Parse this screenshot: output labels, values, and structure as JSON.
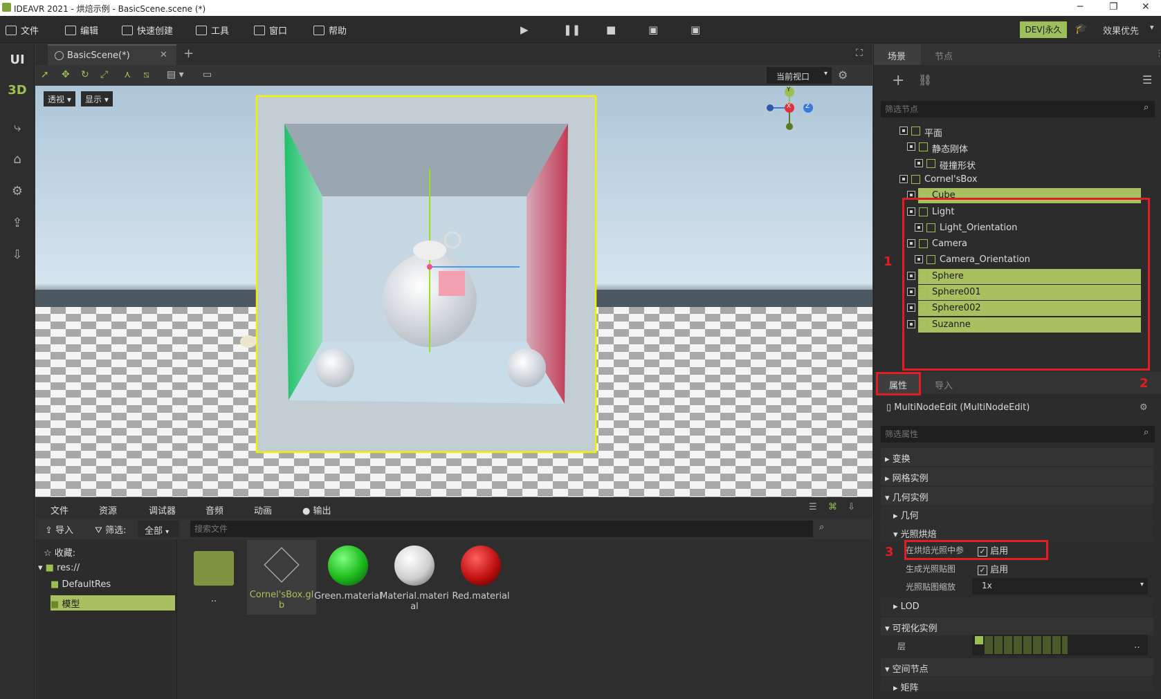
{
  "window": {
    "title": "IDEAVR 2021 - 烘焙示例 - BasicScene.scene (*)"
  },
  "menu": {
    "file": "文件",
    "edit": "编辑",
    "quick_create": "快速创建",
    "tools": "工具",
    "window": "窗口",
    "help": "帮助"
  },
  "header": {
    "dev_badge": "DEV|永久",
    "quality": "效果优先"
  },
  "left_tools": {
    "ui": "UI",
    "three_d": "3D"
  },
  "viewport": {
    "tab_label": "BasicScene(*)",
    "view_select": "当前视口",
    "perspective_btn": "透视",
    "display_btn": "显示",
    "gizmo": {
      "y": "Y",
      "x": "X",
      "z": "Z"
    }
  },
  "bottom": {
    "tabs": [
      "文件",
      "资源",
      "调试器",
      "音频",
      "动画",
      "输出"
    ],
    "import_label": "导入",
    "filter_label": "筛选:",
    "filter_value": "全部",
    "search_placeholder": "搜索文件",
    "tree": {
      "favorites": "收藏:",
      "res": "res://",
      "default_res": "DefaultRes",
      "models": "模型"
    },
    "assets": [
      {
        "name": "..",
        "kind": "folder"
      },
      {
        "name": "Cornel'sBox.glb",
        "kind": "mesh"
      },
      {
        "name": "Green.material",
        "kind": "material",
        "color": "#1cb81c"
      },
      {
        "name": "Material.material",
        "kind": "material",
        "color": "#cfcfcf"
      },
      {
        "name": "Red.material",
        "kind": "material",
        "color": "#c01010"
      }
    ]
  },
  "scene_panel": {
    "tabs": {
      "scene": "场景",
      "node": "节点"
    },
    "filter_placeholder": "筛选节点",
    "nodes": [
      {
        "label": "平面",
        "indent": 1,
        "highlight": false
      },
      {
        "label": "静态刚体",
        "indent": 2,
        "highlight": false
      },
      {
        "label": "碰撞形状",
        "indent": 3,
        "highlight": false
      },
      {
        "label": "Cornel'sBox",
        "indent": 1,
        "highlight": false
      },
      {
        "label": "Cube",
        "indent": 2,
        "highlight": true
      },
      {
        "label": "Light",
        "indent": 2,
        "highlight": false
      },
      {
        "label": "Light_Orientation",
        "indent": 3,
        "highlight": false
      },
      {
        "label": "Camera",
        "indent": 2,
        "highlight": false
      },
      {
        "label": "Camera_Orientation",
        "indent": 3,
        "highlight": false
      },
      {
        "label": "Sphere",
        "indent": 2,
        "highlight": true
      },
      {
        "label": "Sphere001",
        "indent": 2,
        "highlight": true
      },
      {
        "label": "Sphere002",
        "indent": 2,
        "highlight": true
      },
      {
        "label": "Suzanne",
        "indent": 2,
        "highlight": true
      }
    ]
  },
  "inspector": {
    "tabs": {
      "props": "属性",
      "import": "导入"
    },
    "title": "MultiNodeEdit (MultiNodeEdit)",
    "filter_placeholder": "筛选属性",
    "sections": {
      "transform": "变换",
      "mesh_instance": "网格实例",
      "geometry_instance": "几何实例",
      "geometry": "几何",
      "light_bake": "光照烘焙",
      "lod": "LOD",
      "visual_instance": "可视化实例",
      "spatial": "空间节点",
      "matrix": "矩阵"
    },
    "props": {
      "bake_in_light": "在烘焙光照中参",
      "gen_lightmap": "生成光照贴图",
      "lightmap_scale": "光照贴图缩放",
      "enabled": "启用",
      "scale_value": "1x",
      "layer": "层"
    }
  },
  "annotations": {
    "one": "1",
    "two": "2",
    "three": "3"
  },
  "colors": {
    "accent": "#a8c060",
    "red_annotation": "#e01e24"
  }
}
